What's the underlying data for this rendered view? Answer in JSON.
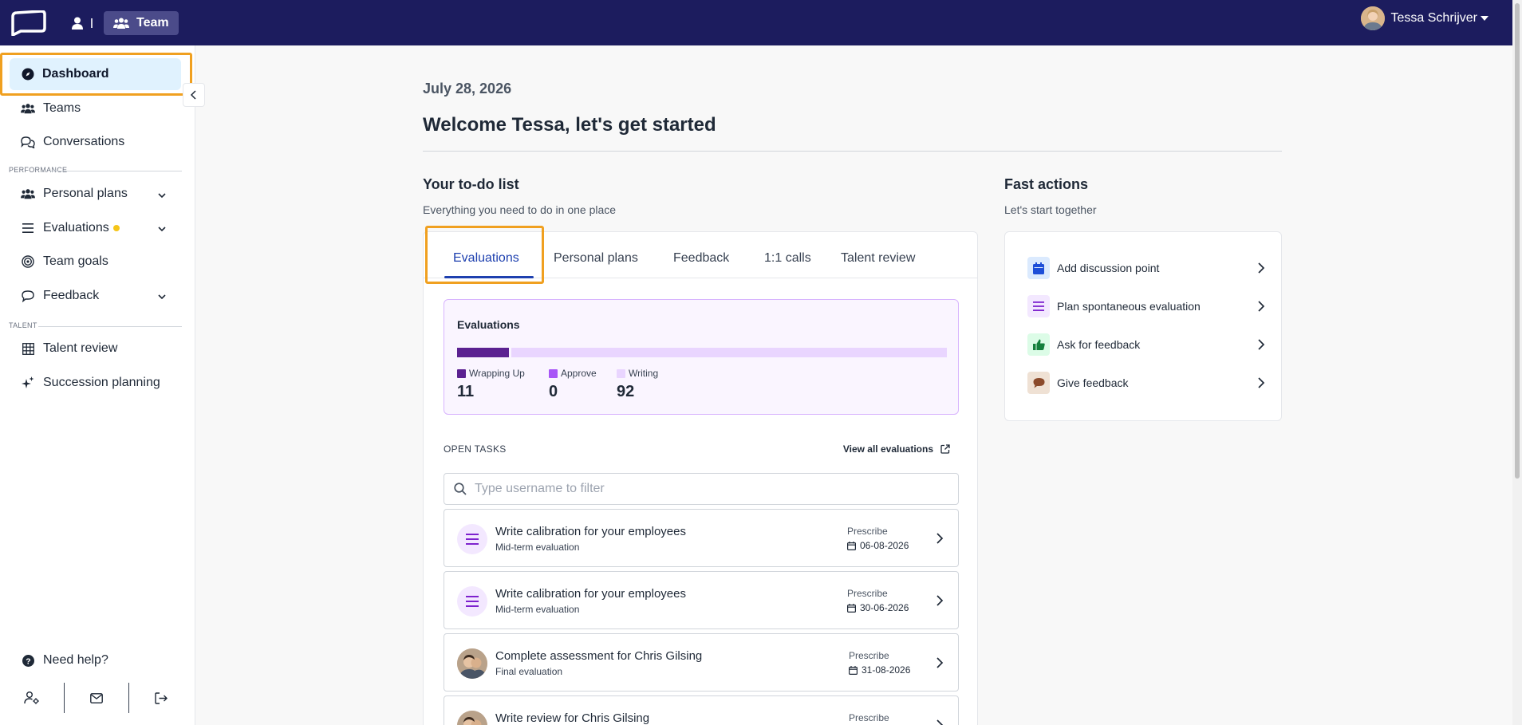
{
  "topbar": {
    "team_label": "Team",
    "user_name": "Tessa Schrijver"
  },
  "sidebar": {
    "dashboard": "Dashboard",
    "teams": "Teams",
    "conversations": "Conversations",
    "section_performance": "PERFORMANCE",
    "personal_plans": "Personal plans",
    "evaluations": "Evaluations",
    "team_goals": "Team goals",
    "feedback": "Feedback",
    "section_talent": "TALENT",
    "talent_review": "Talent review",
    "succession_planning": "Succession planning",
    "need_help": "Need help?"
  },
  "main": {
    "date": "July 28, 2026",
    "welcome": "Welcome Tessa, let's get started",
    "todo_title": "Your to-do list",
    "todo_sub": "Everything you need to do in one place",
    "fast_title": "Fast actions",
    "fast_sub": "Let's start together"
  },
  "tabs": [
    "Evaluations",
    "Personal plans",
    "Feedback",
    "1:1 calls",
    "Talent review"
  ],
  "evaluations_summary": {
    "title": "Evaluations",
    "legend": [
      {
        "label": "Wrapping Up",
        "count": "11",
        "color": "#5b2191"
      },
      {
        "label": "Approve",
        "count": "0",
        "color": "#a855f7"
      },
      {
        "label": "Writing",
        "count": "92",
        "color": "#e9d5ff"
      }
    ]
  },
  "open_tasks": {
    "label": "OPEN TASKS",
    "view_all": "View all evaluations",
    "filter_placeholder": "Type username to filter",
    "tasks": [
      {
        "title": "Write calibration for your employees",
        "subtitle": "Mid-term evaluation",
        "due_label": "Prescribe",
        "due_date": "06-08-2026",
        "icon": "list-icon"
      },
      {
        "title": "Write calibration for your employees",
        "subtitle": "Mid-term evaluation",
        "due_label": "Prescribe",
        "due_date": "30-06-2026",
        "icon": "list-icon"
      },
      {
        "title": "Complete assessment for Chris Gilsing",
        "subtitle": "Final evaluation",
        "due_label": "Prescribe",
        "due_date": "31-08-2026",
        "icon": "avatar"
      },
      {
        "title": "Write review for Chris Gilsing",
        "subtitle": "",
        "due_label": "Prescribe",
        "due_date": "",
        "icon": "avatar"
      }
    ]
  },
  "fast_actions": [
    {
      "label": "Add discussion point",
      "icon": "calendar-icon",
      "bg": "#dbeafe",
      "fg": "#1d4ed8"
    },
    {
      "label": "Plan spontaneous evaluation",
      "icon": "list-icon",
      "bg": "#f3e8ff",
      "fg": "#7e22ce"
    },
    {
      "label": "Ask for feedback",
      "icon": "thumbs-up-icon",
      "bg": "#dcfce7",
      "fg": "#15803d"
    },
    {
      "label": "Give feedback",
      "icon": "speech-bubble-icon",
      "bg": "#efe1d4",
      "fg": "#8b4a2b"
    }
  ]
}
